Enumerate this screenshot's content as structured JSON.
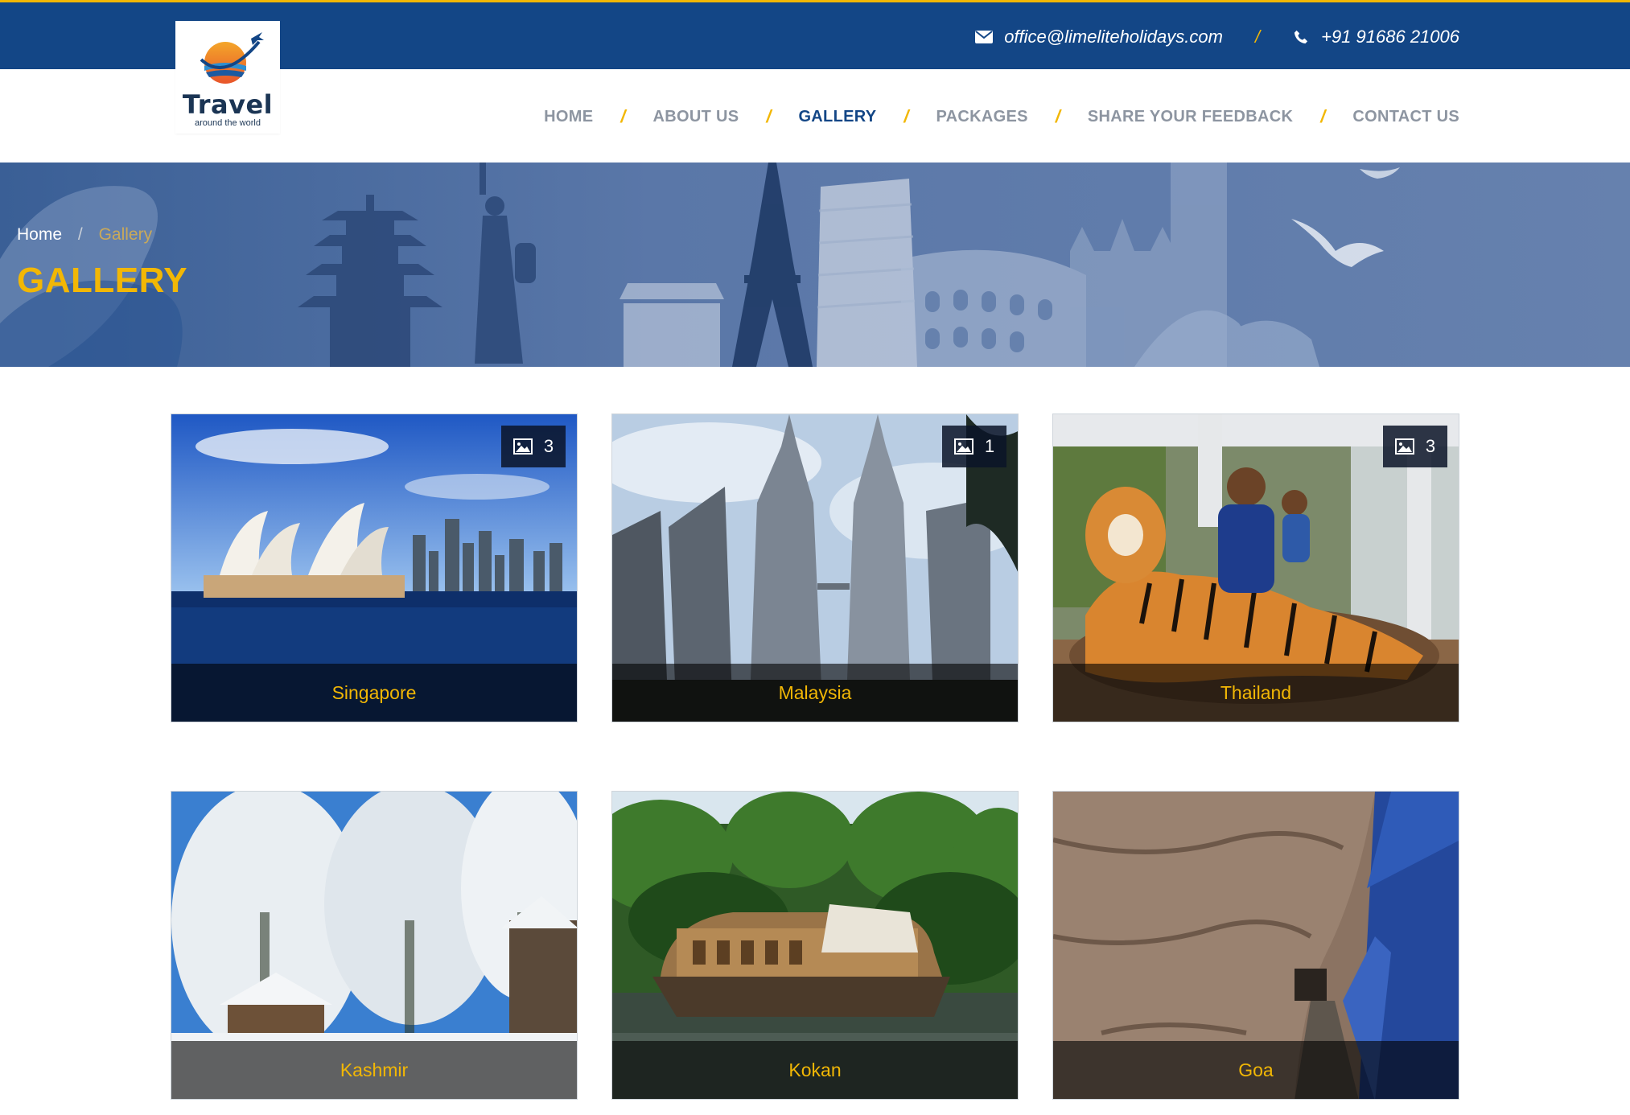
{
  "header": {
    "email": "office@limeliteholidays.com",
    "phone": "+91 91686 21006",
    "separator": "/",
    "email_icon": "envelope-icon",
    "phone_icon": "phone-icon"
  },
  "logo": {
    "title": "Travel",
    "tagline": "around the world"
  },
  "nav": {
    "separator": "/",
    "items": [
      {
        "label": "HOME"
      },
      {
        "label": "ABOUT US"
      },
      {
        "label": "GALLERY",
        "active": true
      },
      {
        "label": "PACKAGES"
      },
      {
        "label": "SHARE YOUR FEEDBACK"
      },
      {
        "label": "CONTACT US"
      }
    ]
  },
  "breadcrumb": {
    "home": "Home",
    "separator": "/",
    "current": "Gallery"
  },
  "page_title": "GALLERY",
  "gallery": [
    {
      "name": "Singapore",
      "count": "3"
    },
    {
      "name": "Malaysia",
      "count": "1"
    },
    {
      "name": "Thailand",
      "count": "3"
    },
    {
      "name": "Kashmir"
    },
    {
      "name": "Kokan"
    },
    {
      "name": "Goa"
    }
  ],
  "colors": {
    "brand": "#134686",
    "accent": "#f2b705"
  }
}
